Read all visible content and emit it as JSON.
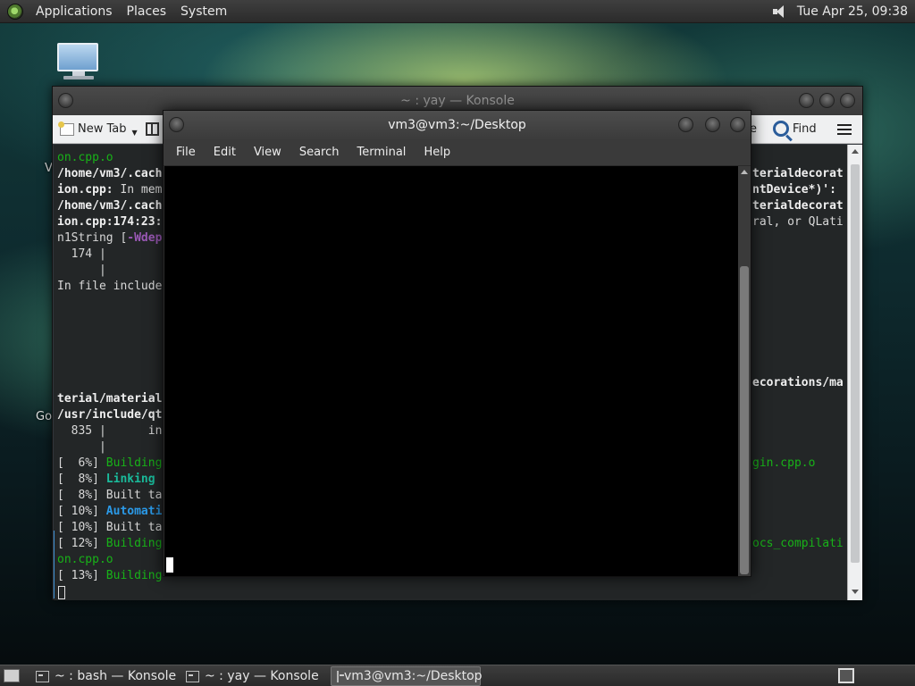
{
  "top_panel": {
    "menus": [
      "Applications",
      "Places",
      "System"
    ],
    "clock": "Tue Apr 25, 09:38"
  },
  "konsole": {
    "title": "~ : yay — Konsole",
    "toolbar": {
      "new_tab": "New Tab",
      "find": "Find",
      "partial": "e"
    },
    "lines": [
      {
        "left": "on.cpp.o",
        "right": ""
      },
      {
        "left": "/home/vm3/.cach",
        "right": "terialdecorat"
      },
      {
        "left": "ion.cpp:",
        "mid": " In mem",
        "right": "ntDevice*)':"
      },
      {
        "left": "/home/vm3/.cach",
        "right": "terialdecorat"
      },
      {
        "left": "ion.cpp:174:23:",
        "right": "ral, or QLati"
      },
      {
        "left": "n1String [",
        "flag": "-Wdep",
        "right": ""
      },
      {
        "left": "  174 |",
        "right": ""
      },
      {
        "left": "      |",
        "right": ""
      },
      {
        "left": "In file include",
        "right": ""
      },
      {
        "left": "terial/material",
        "right": "ecorations/ma"
      },
      {
        "left": "/usr/include/qt",
        "right": ""
      },
      {
        "left": "  835 |      inl",
        "right": ""
      },
      {
        "left": "      |",
        "right": ""
      },
      {
        "left": "[  6%] ",
        "status": "Building",
        "right": "gin.cpp.o"
      },
      {
        "left": "[  8%] ",
        "status": "Linking",
        "right": ""
      },
      {
        "left": "[  8%] Built ta",
        "right": ""
      },
      {
        "left": "[ 10%] ",
        "status": "Automati",
        "right": ""
      },
      {
        "left": "[ 10%] Built ta",
        "right": ""
      },
      {
        "left": "[ 12%] ",
        "status": "Building",
        "right": "ocs_compilati"
      },
      {
        "left": "on.cpp.o",
        "right": ""
      },
      {
        "left": "[ 13%] ",
        "status": "Building",
        "right": ""
      }
    ]
  },
  "terminal": {
    "title": "vm3@vm3:~/Desktop",
    "menu": [
      "File",
      "Edit",
      "View",
      "Search",
      "Terminal",
      "Help"
    ]
  },
  "desktop": {
    "partial_labels": [
      "V",
      "Go"
    ]
  },
  "taskbar": {
    "tasks": [
      {
        "label": "~ : bash — Konsole",
        "active": false
      },
      {
        "label": "~ : yay — Konsole",
        "active": false
      },
      {
        "label": "vm3@vm3:~/Desktop",
        "active": true
      }
    ]
  }
}
